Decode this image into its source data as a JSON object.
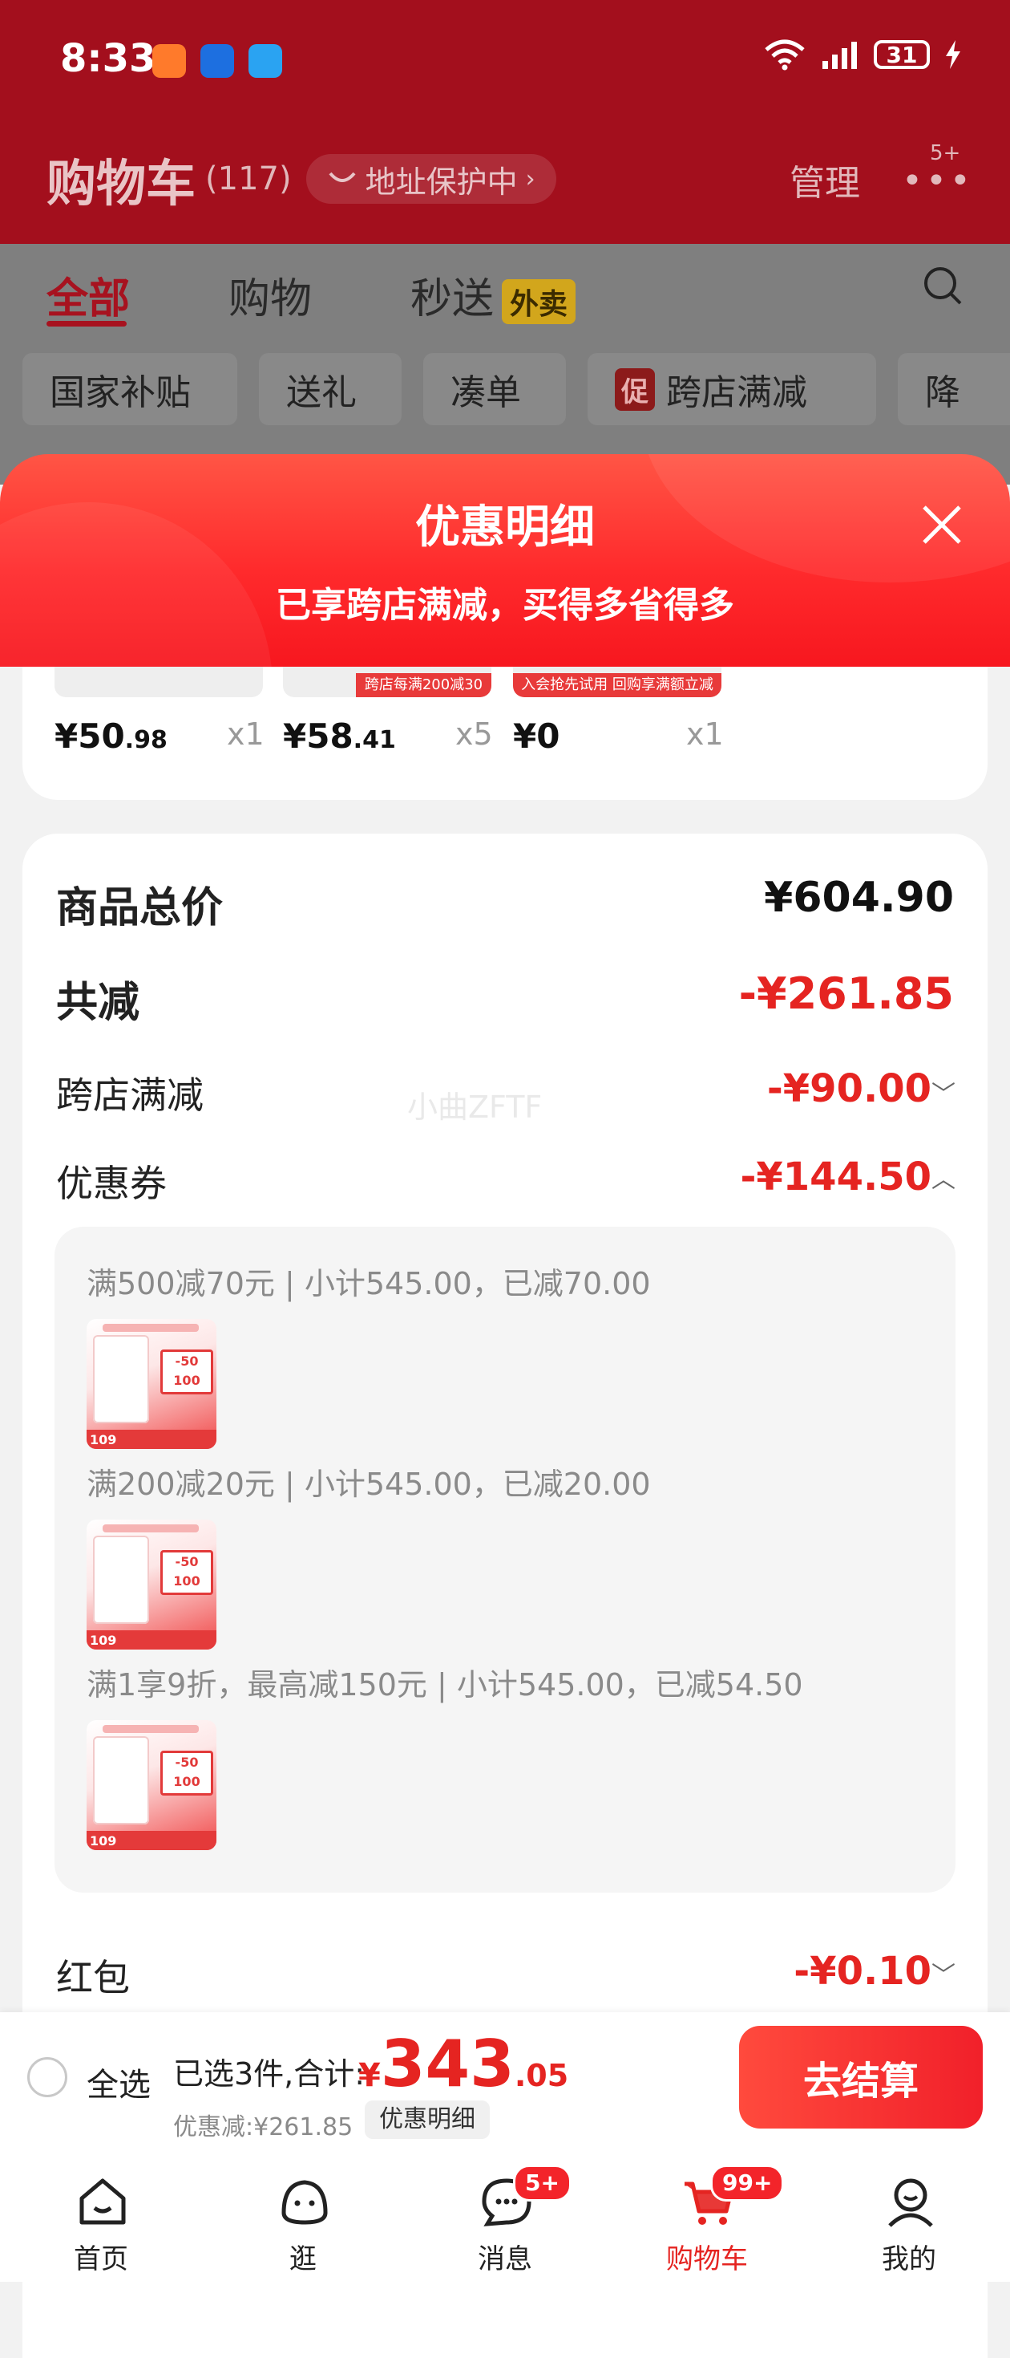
{
  "status_bar": {
    "time": "8:33",
    "battery": "31"
  },
  "header": {
    "title": "购物车",
    "count": "(117)",
    "address_pill": "地址保护中",
    "manage": "管理",
    "more_badge": "5+"
  },
  "tabs": [
    {
      "label": "全部"
    },
    {
      "label": "购物"
    },
    {
      "label": "秒送",
      "tag": "外卖"
    }
  ],
  "chips": [
    "国家补贴",
    "送礼",
    "凑单",
    "跨店满减",
    "降"
  ],
  "chip_tag": "促",
  "sheet": {
    "title": "优惠明细",
    "subtitle": "已享跨店满减，买得多省得多"
  },
  "products": [
    {
      "price_int": "¥50",
      "price_dec": ".98",
      "qty": "x1",
      "strip_text": ""
    },
    {
      "price_int": "¥58",
      "price_dec": ".41",
      "qty": "x5",
      "strip_text": "跨店每满200减30"
    },
    {
      "price_int": "¥0",
      "price_dec": "",
      "qty": "x1",
      "strip_text": "入会抢先试用 回购享满额立减"
    }
  ],
  "summary": {
    "total_label": "商品总价",
    "total_value": "¥604.90",
    "discount_label": "共减",
    "discount_value": "-¥261.85",
    "cross_store_label": "跨店满减",
    "cross_store_value": "-¥90.00",
    "coupon_label": "优惠券",
    "coupon_value": "-¥144.50",
    "red_packet_label": "红包",
    "red_packet_value": "-¥0.10",
    "watermark": "小曲ZFTF"
  },
  "coupon_details": [
    {
      "text": "满500减70元 | 小计545.00，已减70.00"
    },
    {
      "text": "满200减20元 | 小计545.00，已减20.00"
    },
    {
      "text": "满1享9折，最高减150元 | 小计545.00，已减54.50"
    }
  ],
  "product_image": {
    "badge": "-50 100",
    "price": "109"
  },
  "checkout": {
    "select_all": "全选",
    "selected_info": "已选3件,合计:",
    "currency": "¥",
    "total_int": "343",
    "total_dec": ".05",
    "saved": "优惠减:¥261.85",
    "detail_button": "优惠明细",
    "checkout_button": "去结算"
  },
  "nav": [
    {
      "label": "首页",
      "icon": "home-icon"
    },
    {
      "label": "逛",
      "icon": "browse-icon"
    },
    {
      "label": "消息",
      "icon": "message-icon",
      "badge": "5+"
    },
    {
      "label": "购物车",
      "icon": "cart-icon",
      "badge": "99+"
    },
    {
      "label": "我的",
      "icon": "profile-icon"
    }
  ],
  "colors": {
    "brand_red": "#e52421",
    "header_dark": "#a30f1d",
    "sheet_red": "#ff2a2c"
  }
}
